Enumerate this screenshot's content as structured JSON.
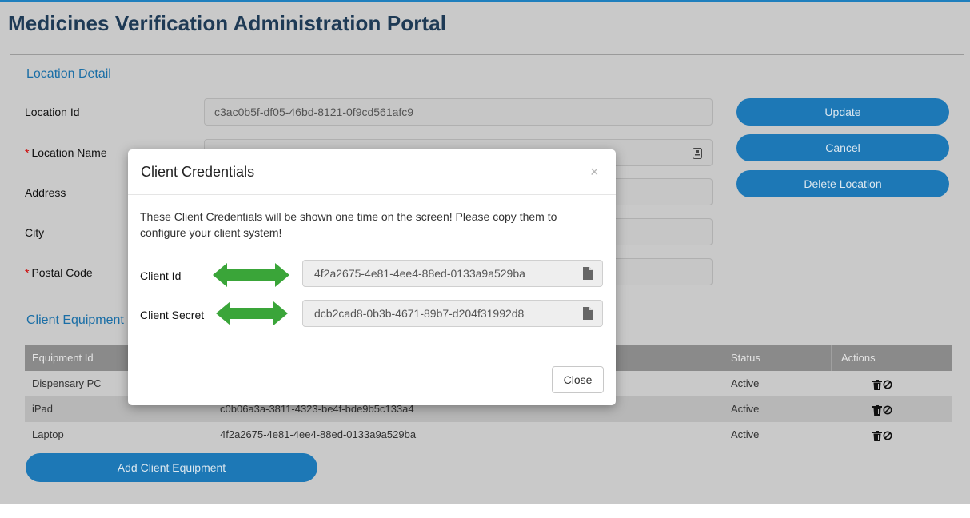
{
  "app": {
    "title": "Medicines Verification Administration Portal"
  },
  "location_detail": {
    "section_title": "Location Detail",
    "fields": {
      "location_id": {
        "label": "Location Id",
        "value": "c3ac0b5f-df05-46bd-8121-0f9cd561afc9"
      },
      "location_name": {
        "required_mark": "*",
        "label": "Location Name"
      },
      "address": {
        "label": "Address"
      },
      "city": {
        "label": "City"
      },
      "postal_code": {
        "required_mark": "*",
        "label": "Postal Code"
      }
    },
    "buttons": {
      "update": "Update",
      "cancel": "Cancel",
      "delete": "Delete Location"
    }
  },
  "client_equipment": {
    "section_title": "Client Equipment",
    "columns": [
      "Equipment Id",
      "",
      "Status",
      "Actions"
    ],
    "rows": [
      {
        "equipment_id": "Dispensary PC",
        "client_id": "",
        "status": "Active"
      },
      {
        "equipment_id": "iPad",
        "client_id": "c0b06a3a-3811-4323-be4f-bde9b5c133a4",
        "status": "Active"
      },
      {
        "equipment_id": "Laptop",
        "client_id": "4f2a2675-4e81-4ee4-88ed-0133a9a529ba",
        "status": "Active"
      }
    ],
    "add_button": "Add Client Equipment"
  },
  "modal": {
    "title": "Client Credentials",
    "close_x": "×",
    "message": "These Client Credentials will be shown one time on the screen! Please copy them to configure your client system!",
    "client_id": {
      "label": "Client Id",
      "value": "4f2a2675-4e81-4ee4-88ed-0133a9a529ba"
    },
    "client_secret": {
      "label": "Client Secret",
      "value": "dcb2cad8-0b3b-4671-89b7-d204f31992d8"
    },
    "close_button": "Close"
  },
  "colors": {
    "primary": "#1d78b6",
    "section_title": "#1a6ea6",
    "annotation_arrow": "#3aa539",
    "table_header": "#8a8a8a"
  },
  "icons": [
    "trash-icon",
    "block-icon",
    "copy-icon",
    "id-card-icon",
    "double-arrow-icon"
  ]
}
